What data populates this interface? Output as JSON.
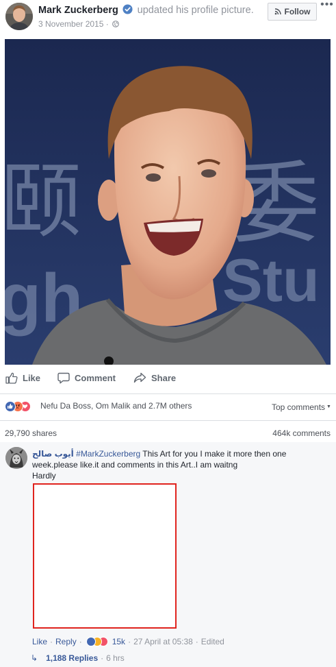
{
  "post": {
    "author": "Mark Zuckerberg",
    "action": "updated his profile picture.",
    "date": "3 November 2015",
    "date_separator": "·",
    "follow_label": "Follow",
    "more_label": "•••",
    "photo_bg_text": [
      "颐",
      "委",
      "gh",
      "Stu"
    ]
  },
  "actions": {
    "like": "Like",
    "comment": "Comment",
    "share": "Share"
  },
  "reactions": {
    "icons": [
      "like-icon",
      "angry-icon",
      "love-icon"
    ],
    "text": "Nefu Da Boss, Om Malik and 2.7M others",
    "top_comments": "Top comments",
    "caret": "▼",
    "shares": "29,790 shares",
    "comments": "464k comments"
  },
  "comment": {
    "author": "أيوب صالح",
    "tag": "#MarkZuckerberg",
    "text": " This Art for you I make it more then one week.please like.it and comments in this Art..I am waitng",
    "second_line": "Hardly",
    "like": "Like",
    "reply": "Reply",
    "dot": "·",
    "reaction_icons": [
      "like-icon",
      "wow-icon",
      "love-icon"
    ],
    "reaction_count": "15k",
    "timestamp": "27 April at 05:38",
    "edited": "Edited",
    "replies_arrow": "↳",
    "replies_count": "1,188 Replies",
    "replies_time": "6 hrs"
  },
  "colors": {
    "link": "#385898",
    "meta": "#90949c",
    "like": "#4267b2",
    "love": "#f25268",
    "angry": "#f7714b",
    "wow": "#f7b125",
    "highlight_box": "#e0231e"
  }
}
